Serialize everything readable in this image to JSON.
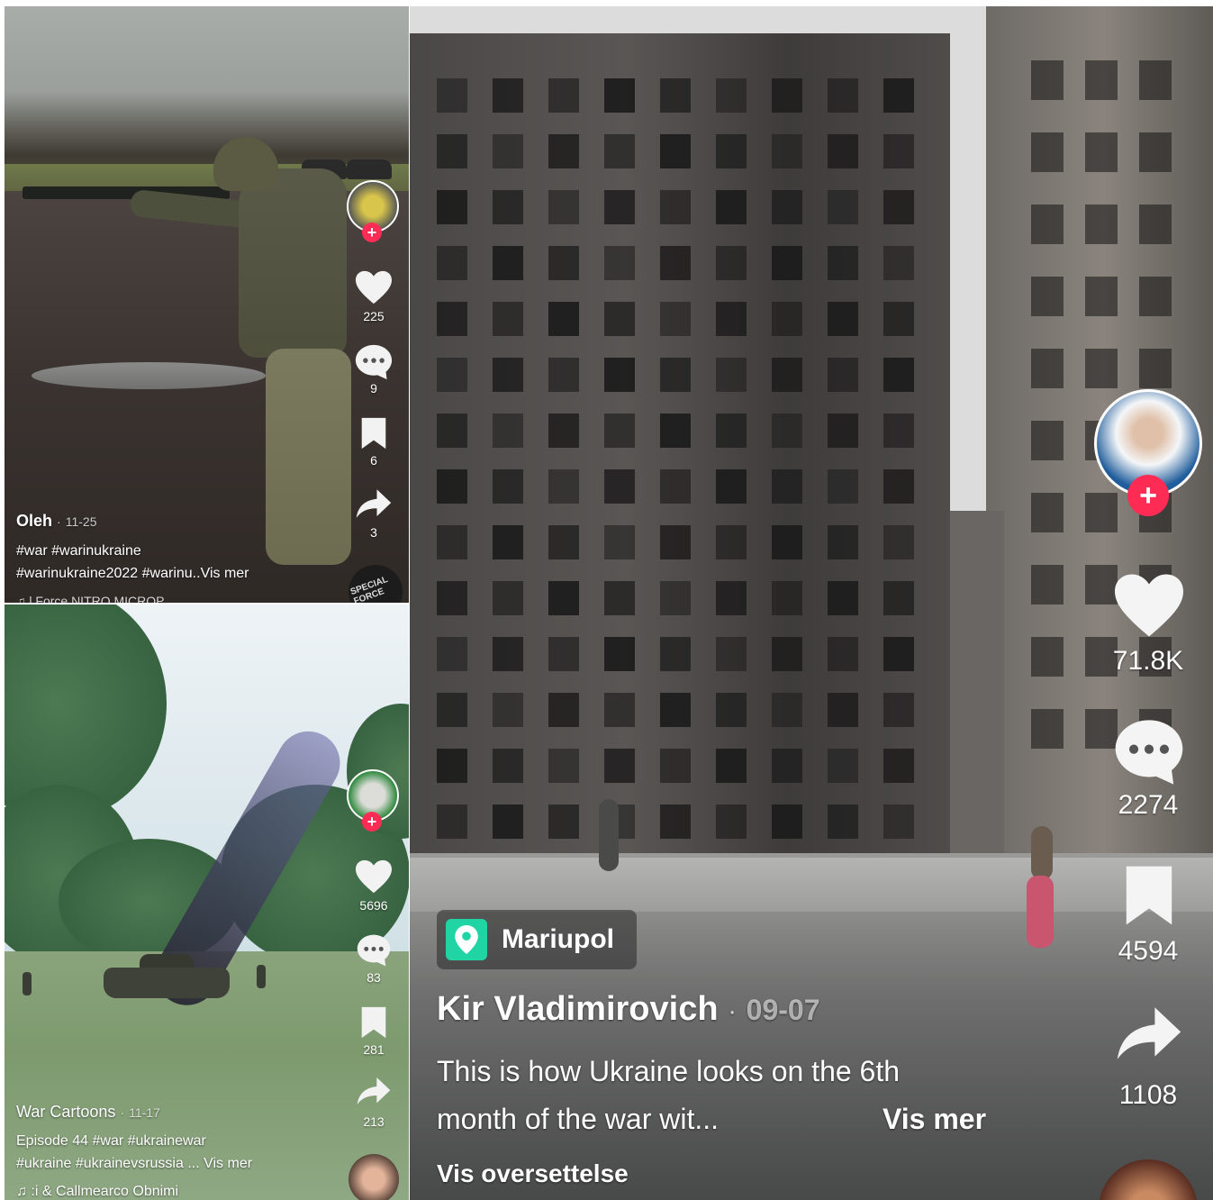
{
  "panels": [
    {
      "username": "Oleh",
      "date": "11-25",
      "caption_line1": "#war #warinukraine",
      "caption_line2": "#warinukraine2022 #warinu..Vis mer",
      "music": "♫ l Force   NITRO MICROP",
      "likes": "225",
      "comments": "9",
      "saves": "6",
      "shares": "3",
      "badge_text": "SPECIAL FORCE"
    },
    {
      "username": "War Cartoons",
      "date": "11-17",
      "caption_line1": "Episode 44  #war #ukrainewar",
      "caption_line2": "#ukraine #ukrainevsrussia ...  Vis mer",
      "music": "♫ :i & Callmearco   Obnimi",
      "likes": "5696",
      "comments": "83",
      "saves": "281",
      "shares": "213"
    },
    {
      "location": "Mariupol",
      "username": "Kir Vladimirovich",
      "date": "09-07",
      "caption_line1": "This is how Ukraine looks on the 6th",
      "caption_line2": "month of the war wit...",
      "see_more": "Vis mer",
      "translate": "Vis oversettelse",
      "likes": "71.8K",
      "comments": "2274",
      "saves": "4594",
      "shares": "1108"
    }
  ],
  "icons": {
    "follow": "+",
    "separator": "·"
  },
  "colors": {
    "follow_badge": "#fe2c55",
    "location_icon": "#20d5a3"
  }
}
